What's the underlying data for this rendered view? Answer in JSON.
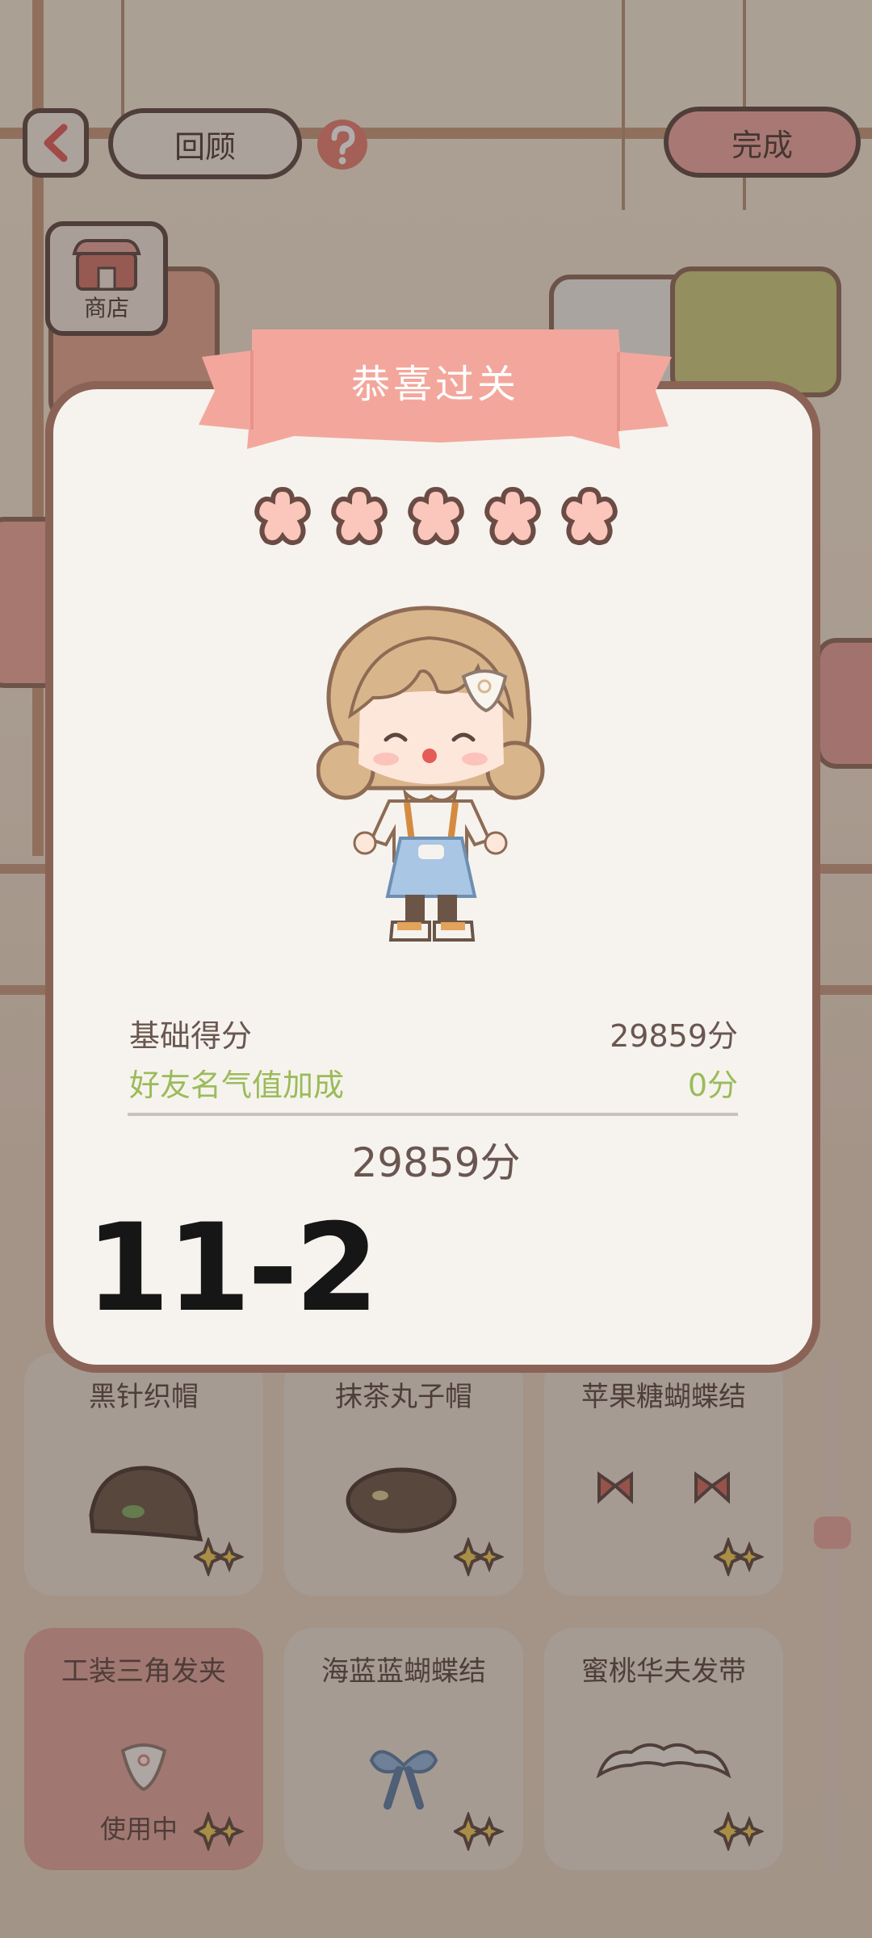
{
  "top_bar": {
    "review_label": "回顾",
    "done_label": "完成",
    "shop_label": "商店"
  },
  "dialog": {
    "title": "恭喜过关",
    "stars_earned": 5,
    "stars_total": 5,
    "base_score_label": "基础得分",
    "base_score_value": "29859分",
    "bonus_label": "好友名气值加成",
    "bonus_value": "0分",
    "total_value": "29859分"
  },
  "overlay_text": "11-2",
  "items": [
    {
      "name": "黑针织帽",
      "icon": "knit-hat-icon"
    },
    {
      "name": "抹茶丸子帽",
      "icon": "beret-icon"
    },
    {
      "name": "苹果糖蝴蝶结",
      "icon": "bow-pair-icon"
    },
    {
      "name": "工装三角发夹",
      "icon": "triangle-clip-icon",
      "status": "使用中"
    },
    {
      "name": "海蓝蓝蝴蝶结",
      "icon": "blue-bow-icon"
    },
    {
      "name": "蜜桃华夫发带",
      "icon": "headband-icon"
    }
  ],
  "colors": {
    "accent_pink": "#f3a79c",
    "score_green": "#9bbb5a",
    "outline_brown": "#8a6356"
  }
}
